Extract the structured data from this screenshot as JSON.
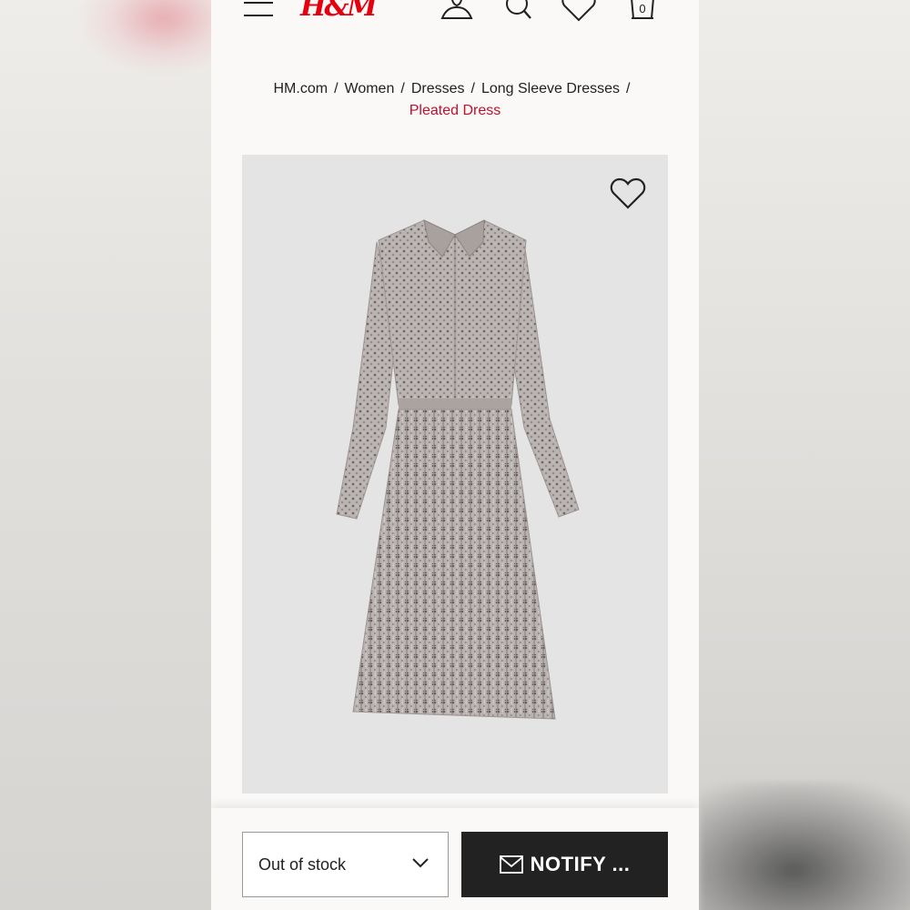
{
  "header": {
    "logo_text": "H&M",
    "bag_count": "0",
    "icons": [
      "menu-icon",
      "account-icon",
      "search-icon",
      "heart-icon",
      "bag-icon"
    ]
  },
  "breadcrumb": {
    "items": [
      "HM.com",
      "Women",
      "Dresses",
      "Long Sleeve Dresses"
    ],
    "separator": "/",
    "current": "Pleated Dress"
  },
  "product": {
    "image_icon": "heart-icon"
  },
  "actions": {
    "size_value": "Out of stock",
    "notify_label": "NOTIFY ..."
  },
  "colors": {
    "brand": "#e50010",
    "current_crumb": "#c0102b",
    "button_bg": "#222222"
  }
}
